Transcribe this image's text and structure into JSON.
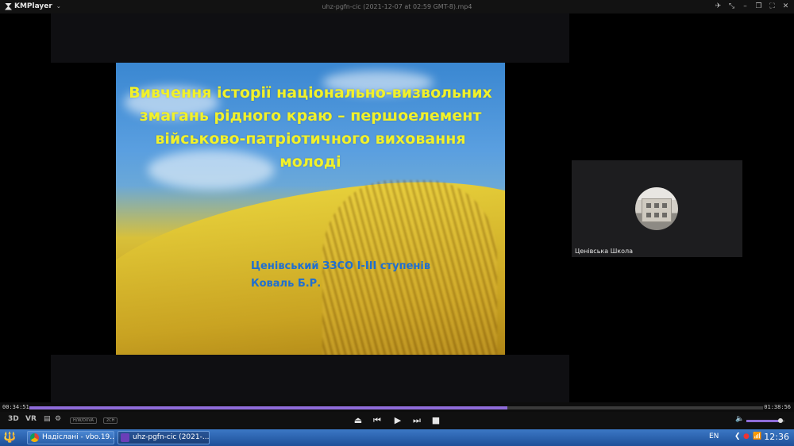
{
  "app": {
    "name": "KMPlayer",
    "window_title": "uhz-pgfn-cic (2021-12-07 at 02:59 GMT-8).mp4"
  },
  "titlebar_icons": [
    "pin-icon",
    "collapse-icon",
    "minimize-icon",
    "restore-icon",
    "fullscreen-icon",
    "close-icon"
  ],
  "slide": {
    "title_lines": [
      "Вивчення історії національно-визвольних",
      "змагань рідного краю – першоелемент",
      "військово-патріотичного виховання",
      "молоді"
    ],
    "subtitle_lines": [
      "Ценівський ЗЗСО І-ІІІ ступенів",
      "Коваль Б.Р."
    ],
    "title_color": "#f1f12a",
    "subtitle_color": "#1f6fd0"
  },
  "participant": {
    "name": "Ценівська Школа"
  },
  "playback": {
    "elapsed": "00:34:51",
    "total": "01:38:56",
    "progress": 0.652,
    "volume": 0.92
  },
  "controls": {
    "left_labels": [
      "3D",
      "VR"
    ],
    "pill_labels": [
      "H/W/DXVA",
      "2CH"
    ]
  },
  "accent_color": "#8f6cd9",
  "taskbar": {
    "items": [
      {
        "label": "Надіслані - vbo.19..."
      },
      {
        "label": "uhz-pgfn-cic (2021-..."
      }
    ],
    "language": "EN",
    "time": "12:36"
  }
}
